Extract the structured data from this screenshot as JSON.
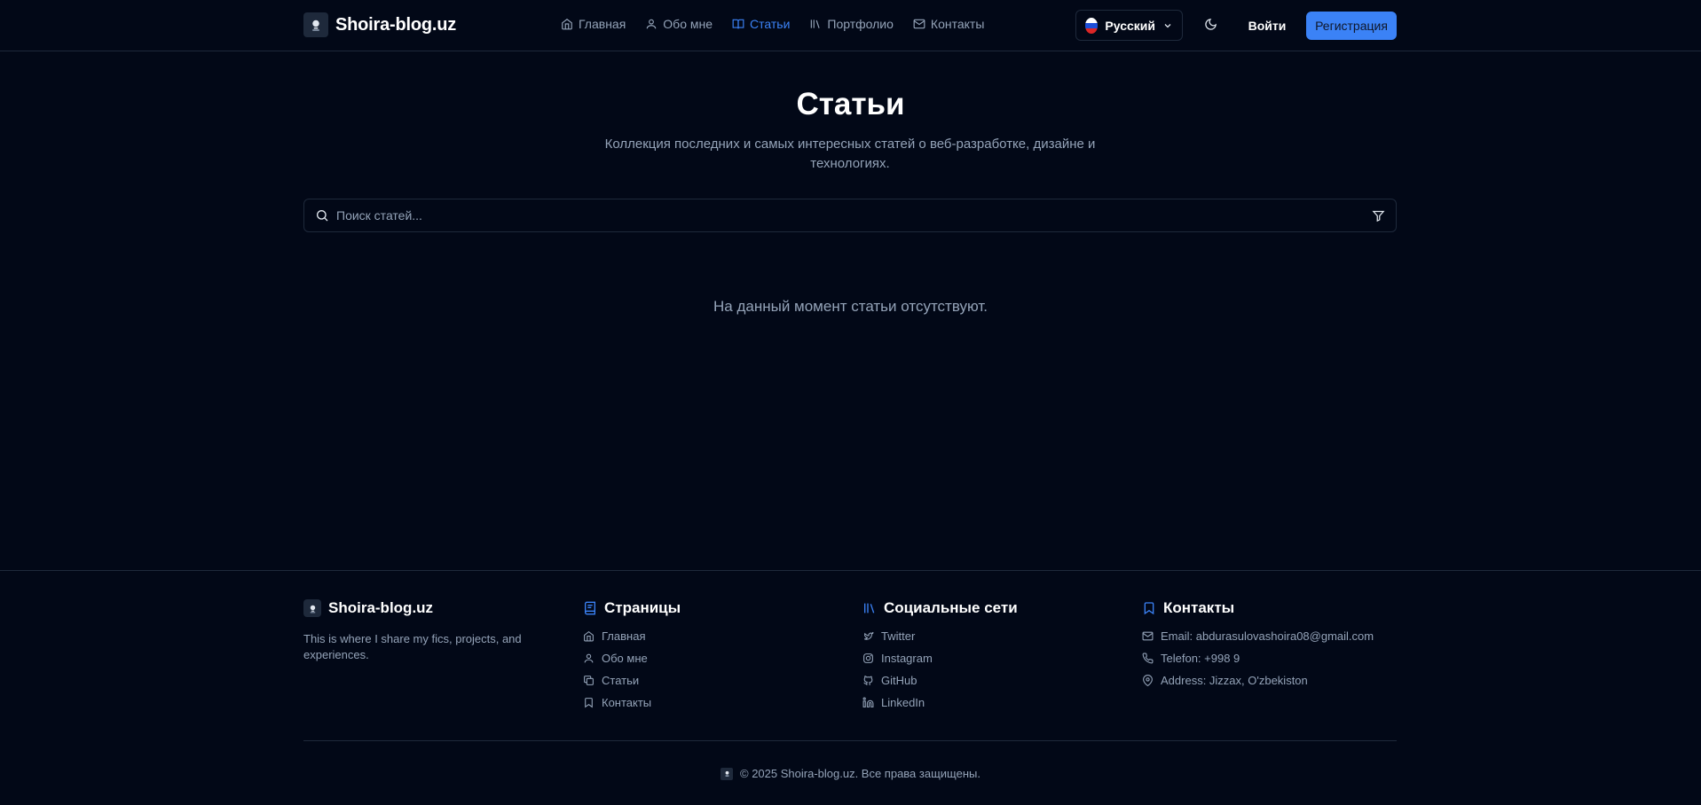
{
  "brand": {
    "name": "Shoira-blog.uz"
  },
  "nav": [
    {
      "label": "Главная",
      "icon": "home-icon"
    },
    {
      "label": "Обо мне",
      "icon": "user-icon"
    },
    {
      "label": "Статьи",
      "icon": "book-open-icon",
      "active": true
    },
    {
      "label": "Портфолио",
      "icon": "library-icon"
    },
    {
      "label": "Контакты",
      "icon": "mail-icon"
    }
  ],
  "header": {
    "language": "Русский",
    "login": "Войти",
    "register": "Регистрация"
  },
  "main": {
    "title": "Статьи",
    "subtitle": "Коллекция последних и самых интересных статей о веб-разработке, дизайне и технологиях.",
    "search_placeholder": "Поиск статей...",
    "empty": "На данный момент статьи отсутствуют."
  },
  "footer": {
    "brand": {
      "name": "Shoira-blog.uz",
      "description": "This is where I share my fics, projects, and experiences."
    },
    "pages": {
      "title": "Страницы",
      "items": [
        "Главная",
        "Обо мне",
        "Статьи",
        "Контакты"
      ]
    },
    "social": {
      "title": "Социальные сети",
      "items": [
        "Twitter",
        "Instagram",
        "GitHub",
        "LinkedIn"
      ]
    },
    "contacts": {
      "title": "Контакты",
      "email": "Email: abdurasulovashoira08@gmail.com",
      "phone": "Telefon: +998 9",
      "address": "Address: Jizzax, O'zbekiston"
    },
    "copyright": "© 2025 Shoira-blog.uz. Все права защищены."
  },
  "colors": {
    "background": "#020817",
    "accent": "#3b82f6",
    "muted": "#94a3b8",
    "border": "#1e293b"
  }
}
